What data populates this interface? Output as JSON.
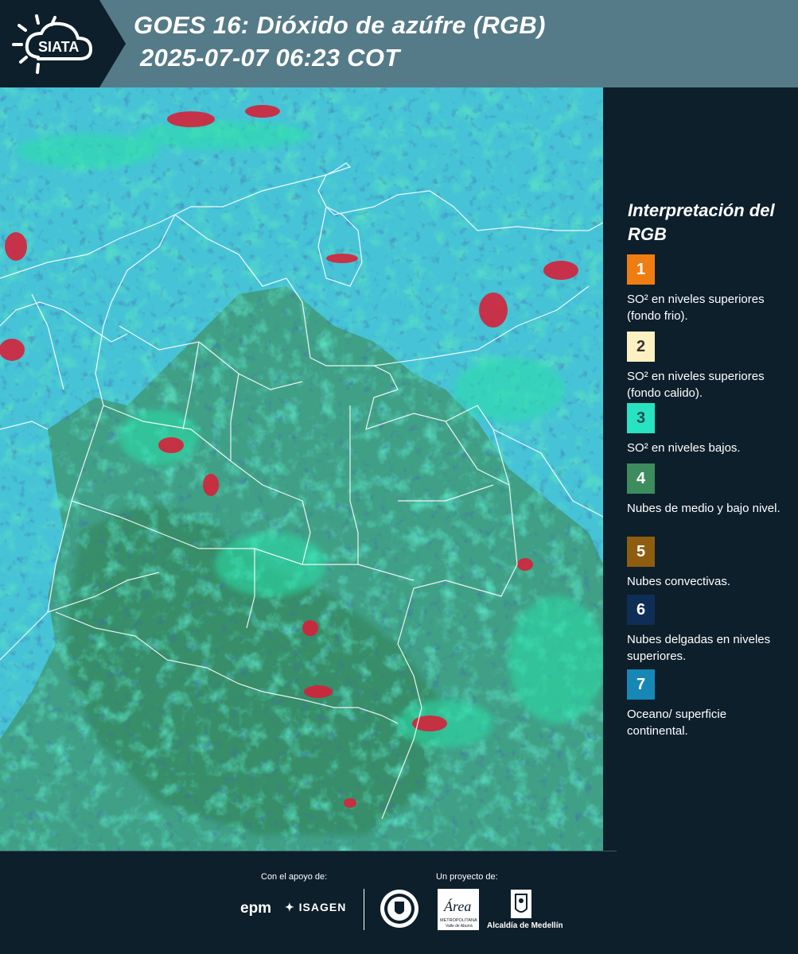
{
  "header": {
    "title_line_1": "GOES 16: Dióxido de azúfre (RGB)",
    "title_line_2": "2025-07-07 06:23 COT",
    "logo_text": "SIATA"
  },
  "legend": {
    "title": "Interpretación del RGB",
    "items": [
      {
        "number": "1",
        "color": "#f07d12",
        "label": "SO² en niveles superiores (fondo frio)."
      },
      {
        "number": "2",
        "color": "#fdf1c1",
        "label": "SO² en niveles superiores (fondo calido)."
      },
      {
        "number": "3",
        "color": "#27e3c1",
        "label": "SO² en niveles bajos."
      },
      {
        "number": "4",
        "color": "#3d8c5d",
        "label": "Nubes de medio y bajo nivel."
      },
      {
        "number": "5",
        "color": "#8e5d10",
        "label": "Nubes convectivas."
      },
      {
        "number": "6",
        "color": "#0f2e57",
        "label": "Nubes delgadas en niveles superiores."
      },
      {
        "number": "7",
        "color": "#1788b5",
        "label": "Oceano/ superficie continental."
      }
    ]
  },
  "footer": {
    "support_label": "Con el apoyo de:",
    "project_label": "Un proyecto de:",
    "epm": "epm",
    "isagen": "ISAGEN",
    "area_label": "Área",
    "area_sub_1": "METROPOLITANA",
    "area_sub_2": "Valle de Aburrá",
    "alcaldia": "Alcaldía de Medellín"
  },
  "colors": {
    "background": "#0d1f2b",
    "header_band": "#557a88",
    "ocean": "#46c3d6",
    "land": "#3f9a78",
    "low_cloud": "#2fd6a6",
    "convective_red": "#d4223a"
  }
}
